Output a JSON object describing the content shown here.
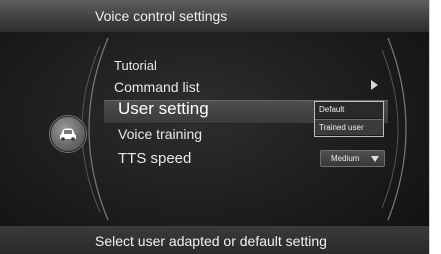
{
  "header": {
    "title": "Voice control settings"
  },
  "menu": {
    "tutorial": "Tutorial",
    "command_list": "Command list",
    "user_setting": "User setting",
    "voice_training": "Voice training",
    "tts_speed": "TTS speed"
  },
  "user_setting_options": [
    "Default",
    "Trained user"
  ],
  "tts_speed_value": "Medium",
  "status": {
    "text": "Select user adapted or default setting"
  },
  "icons": {
    "left_button": "car-icon",
    "command_list_arrow": "chevron-right-icon",
    "dropdown": "caret-down-icon"
  },
  "colors": {
    "background": "#1c1c1c",
    "text": "#e8e8e8",
    "highlight": "#444444",
    "outline": "#bdbdbd"
  }
}
